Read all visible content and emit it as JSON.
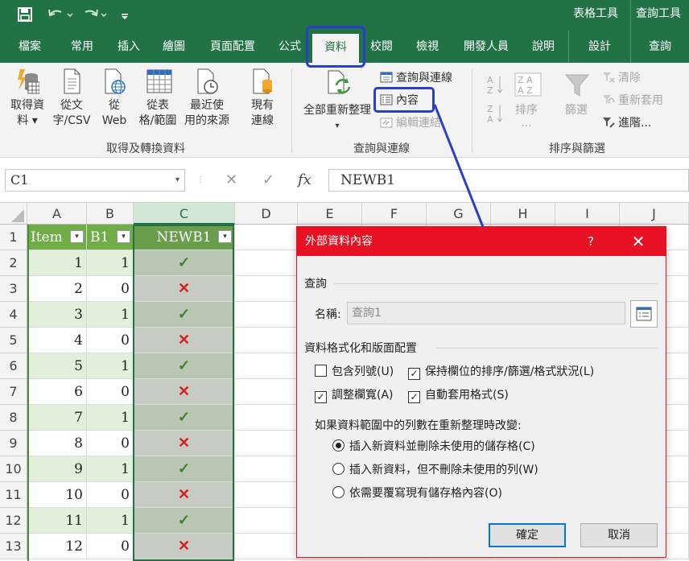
{
  "titlebar": {
    "context_tabs": [
      "表格工具",
      "查詢工具"
    ],
    "qat_icons": [
      "save-icon",
      "undo-icon",
      "redo-icon",
      "customize-qat-icon"
    ]
  },
  "tabs": [
    "檔案",
    "常用",
    "插入",
    "繪圖",
    "頁面配置",
    "公式",
    "資料",
    "校閱",
    "檢視",
    "開發人員",
    "說明",
    "設計",
    "查詢"
  ],
  "active_tab": "資料",
  "ribbon": {
    "get_transform": {
      "name": "取得及轉換資料",
      "get_data": [
        "取得資",
        "料 ▾"
      ],
      "from_text": [
        "從文",
        "字/CSV"
      ],
      "from_web": [
        "從",
        "Web"
      ],
      "from_table": [
        "從表",
        "格/範圍"
      ],
      "recent": [
        "最近使",
        "用的來源"
      ],
      "existing": [
        "現有",
        "連線"
      ]
    },
    "queries": {
      "name": "查詢與連線",
      "refresh_all": "全部重新整理",
      "refresh_dd": "▾",
      "queries_connections": "查詢與連線",
      "properties": "內容",
      "edit_links": "編輯連結"
    },
    "sort_filter": {
      "name": "排序與篩選",
      "sort": [
        "排序",
        "..."
      ],
      "filter": "篩選",
      "clear": "清除",
      "reapply": "重新套用",
      "advanced": "進階..."
    }
  },
  "formula_bar": {
    "name_box": "C1",
    "name_dd": "▾",
    "cancel": "✕",
    "enter": "✓",
    "fx": "fx",
    "content": "NEWB1"
  },
  "grid": {
    "columns": [
      "A",
      "B",
      "C",
      "D",
      "E",
      "F",
      "G",
      "H",
      "I",
      "J"
    ],
    "rows": [
      "1",
      "2",
      "3",
      "4",
      "5",
      "6",
      "7",
      "8",
      "9",
      "10",
      "11",
      "12",
      "13"
    ],
    "headers": [
      "Item",
      "B1",
      "NEWB1"
    ],
    "filter_glyph": "▾",
    "data": [
      {
        "item": "1",
        "b1": "1",
        "mark": "✓"
      },
      {
        "item": "2",
        "b1": "0",
        "mark": "✕"
      },
      {
        "item": "3",
        "b1": "1",
        "mark": "✓"
      },
      {
        "item": "4",
        "b1": "0",
        "mark": "✕"
      },
      {
        "item": "5",
        "b1": "1",
        "mark": "✓"
      },
      {
        "item": "6",
        "b1": "0",
        "mark": "✕"
      },
      {
        "item": "7",
        "b1": "1",
        "mark": "✓"
      },
      {
        "item": "8",
        "b1": "0",
        "mark": "✕"
      },
      {
        "item": "9",
        "b1": "1",
        "mark": "✓"
      },
      {
        "item": "10",
        "b1": "0",
        "mark": "✕"
      },
      {
        "item": "11",
        "b1": "1",
        "mark": "✓"
      },
      {
        "item": "12",
        "b1": "0",
        "mark": "✕"
      }
    ]
  },
  "dialog": {
    "title": "外部資料內容",
    "help": "?",
    "close": "✕",
    "query_section": "查詢",
    "name_label": "名稱:",
    "name_value": "查詢1",
    "format_section": "資料格式化和版面配置",
    "include_row_numbers": "包含列號(U)",
    "preserve_sort": "保持欄位的排序/篩選/格式狀況(L)",
    "adjust_width": "調整欄寬(A)",
    "auto_format": "自動套用格式(S)",
    "check_glyph": "✓",
    "change_prompt": "如果資料範圍中的列數在重新整理時改變:",
    "option_insert_delete": "插入新資料並刪除未使用的儲存格(C)",
    "option_insert_keep": "插入新資料，但不刪除未使用的列(W)",
    "option_overwrite": "依需要覆寫現有儲存格內容(O)",
    "ok": "確定",
    "cancel": "取消"
  },
  "colors": {
    "excel_green": "#217346",
    "table_header": "#70ad47",
    "band": "#e2efda",
    "dialog_accent": "#e81123",
    "annotation": "#2b3fc6",
    "ok_mark": "#3f7f2a",
    "bad_mark": "#d62020"
  }
}
